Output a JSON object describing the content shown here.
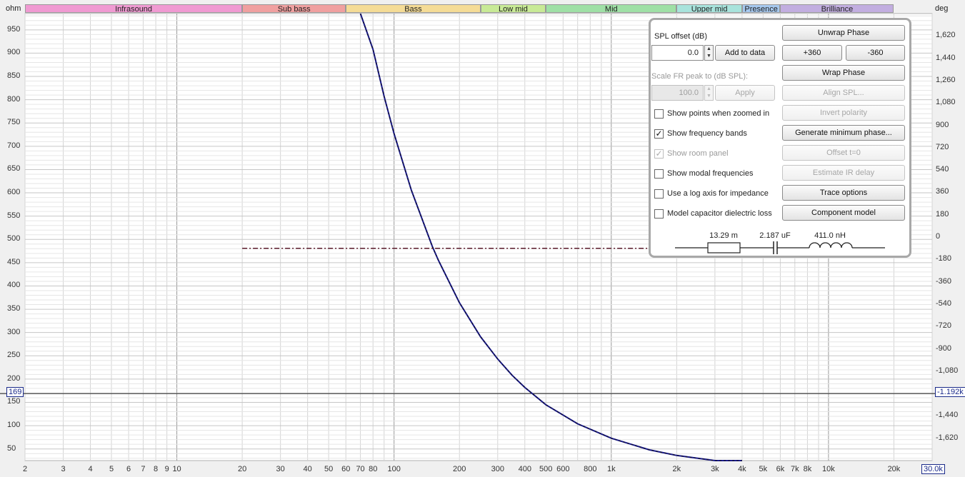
{
  "axes": {
    "left_unit": "ohm",
    "right_unit": "deg",
    "left_cursor_value": "169",
    "right_cursor_value": "-1.192k",
    "x_end_label": "30.0k"
  },
  "bands": [
    {
      "label": "Infrasound",
      "from": 2,
      "to": 20,
      "color": "#f09ad2"
    },
    {
      "label": "Sub bass",
      "from": 20,
      "to": 60,
      "color": "#f0a0a0"
    },
    {
      "label": "Bass",
      "from": 60,
      "to": 250,
      "color": "#f5dc96"
    },
    {
      "label": "Low mid",
      "from": 250,
      "to": 500,
      "color": "#c8ea96"
    },
    {
      "label": "Mid",
      "from": 500,
      "to": 2000,
      "color": "#9fe0a6"
    },
    {
      "label": "Upper mid",
      "from": 2000,
      "to": 4000,
      "color": "#a8e3dc"
    },
    {
      "label": "Presence",
      "from": 4000,
      "to": 6000,
      "color": "#a6c8ee"
    },
    {
      "label": "Brilliance",
      "from": 6000,
      "to": 20000,
      "color": "#c2aee0"
    }
  ],
  "panel": {
    "spl_offset_label": "SPL offset (dB)",
    "spl_offset_value": "0.0",
    "add_to_data": "Add to data",
    "scale_fr_label": "Scale FR peak to (dB SPL):",
    "scale_fr_value": "100.0",
    "apply": "Apply",
    "checkboxes": [
      {
        "label": "Show points when zoomed in",
        "checked": false,
        "disabled": false
      },
      {
        "label": "Show frequency bands",
        "checked": true,
        "disabled": false
      },
      {
        "label": "Show room panel",
        "checked": true,
        "disabled": true
      },
      {
        "label": "Show modal frequencies",
        "checked": false,
        "disabled": false
      },
      {
        "label": "Use a log axis for impedance",
        "checked": false,
        "disabled": false
      },
      {
        "label": "Model capacitor dielectric loss",
        "checked": false,
        "disabled": false
      }
    ],
    "buttons": [
      {
        "label": "Unwrap Phase",
        "disabled": false
      },
      {
        "label": "+360",
        "disabled": false
      },
      {
        "label": "-360",
        "disabled": false
      },
      {
        "label": "Wrap Phase",
        "disabled": false
      },
      {
        "label": "Align SPL...",
        "disabled": true
      },
      {
        "label": "Invert polarity",
        "disabled": true
      },
      {
        "label": "Generate minimum phase...",
        "disabled": false
      },
      {
        "label": "Offset t=0",
        "disabled": true
      },
      {
        "label": "Estimate IR delay",
        "disabled": true
      },
      {
        "label": "Trace options",
        "disabled": false
      },
      {
        "label": "Component model",
        "disabled": false
      }
    ],
    "component_values": {
      "resistor": "13.29 m",
      "capacitor": "2.187 uF",
      "inductor": "411.0 nH"
    }
  },
  "chart_data": {
    "type": "line",
    "title": "",
    "xlabel": "",
    "ylabel": "ohm",
    "y2label": "deg",
    "x_scale": "log",
    "xlim": [
      2,
      30000
    ],
    "ylim": [
      25,
      985
    ],
    "y2lim": [
      -1800,
      1800
    ],
    "grid": true,
    "x_ticks": [
      {
        "v": 2,
        "label": "2"
      },
      {
        "v": 3,
        "label": "3"
      },
      {
        "v": 4,
        "label": "4"
      },
      {
        "v": 5,
        "label": "5"
      },
      {
        "v": 6,
        "label": "6"
      },
      {
        "v": 7,
        "label": "7"
      },
      {
        "v": 8,
        "label": "8"
      },
      {
        "v": 9,
        "label": "9"
      },
      {
        "v": 10,
        "label": "10"
      },
      {
        "v": 20,
        "label": "20"
      },
      {
        "v": 30,
        "label": "30"
      },
      {
        "v": 40,
        "label": "40"
      },
      {
        "v": 50,
        "label": "50"
      },
      {
        "v": 60,
        "label": "60"
      },
      {
        "v": 70,
        "label": "70"
      },
      {
        "v": 80,
        "label": "80"
      },
      {
        "v": 100,
        "label": "100"
      },
      {
        "v": 200,
        "label": "200"
      },
      {
        "v": 300,
        "label": "300"
      },
      {
        "v": 400,
        "label": "400"
      },
      {
        "v": 500,
        "label": "500"
      },
      {
        "v": 600,
        "label": "600"
      },
      {
        "v": 800,
        "label": "800"
      },
      {
        "v": 1000,
        "label": "1k"
      },
      {
        "v": 2000,
        "label": "2k"
      },
      {
        "v": 3000,
        "label": "3k"
      },
      {
        "v": 4000,
        "label": "4k"
      },
      {
        "v": 5000,
        "label": "5k"
      },
      {
        "v": 6000,
        "label": "6k"
      },
      {
        "v": 7000,
        "label": "7k"
      },
      {
        "v": 8000,
        "label": "8k"
      },
      {
        "v": 10000,
        "label": "10k"
      },
      {
        "v": 20000,
        "label": "20k"
      }
    ],
    "y_ticks": [
      50,
      100,
      150,
      200,
      250,
      300,
      350,
      400,
      450,
      500,
      550,
      600,
      650,
      700,
      750,
      800,
      850,
      900,
      950
    ],
    "y2_ticks": [
      {
        "v": 1620,
        "label": "1,620"
      },
      {
        "v": 1440,
        "label": "1,440"
      },
      {
        "v": 1260,
        "label": "1,260"
      },
      {
        "v": 1080,
        "label": "1,080"
      },
      {
        "v": 900,
        "label": "900"
      },
      {
        "v": 720,
        "label": "720"
      },
      {
        "v": 540,
        "label": "540"
      },
      {
        "v": 360,
        "label": "360"
      },
      {
        "v": 180,
        "label": "180"
      },
      {
        "v": 0,
        "label": "0"
      },
      {
        "v": -180,
        "label": "-180"
      },
      {
        "v": -360,
        "label": "-360"
      },
      {
        "v": -540,
        "label": "-540"
      },
      {
        "v": -720,
        "label": "-720"
      },
      {
        "v": -900,
        "label": "-900"
      },
      {
        "v": -1080,
        "label": "-1,080"
      },
      {
        "v": -1260,
        "label": "-1,260"
      },
      {
        "v": -1440,
        "label": "-1,440"
      },
      {
        "v": -1620,
        "label": "-1,620"
      }
    ],
    "cursor_y": 169,
    "series": [
      {
        "axis": "left",
        "color": "#1a1a8c",
        "style": "solid",
        "x": [
          70,
          80,
          90,
          100,
          120,
          150,
          160,
          200,
          250,
          300,
          350,
          400,
          500,
          700,
          1000,
          1500,
          2000,
          3000,
          4000
        ],
        "y": [
          1037,
          908,
          807,
          727,
          606,
          485,
          455,
          364,
          291,
          243,
          208,
          182,
          145,
          104,
          73,
          48,
          36,
          24,
          18
        ]
      },
      {
        "axis": "right",
        "color": "#5a1a2a",
        "style": "dash-dot",
        "x": [
          20,
          20000
        ],
        "y": [
          -90,
          -90
        ]
      }
    ]
  }
}
